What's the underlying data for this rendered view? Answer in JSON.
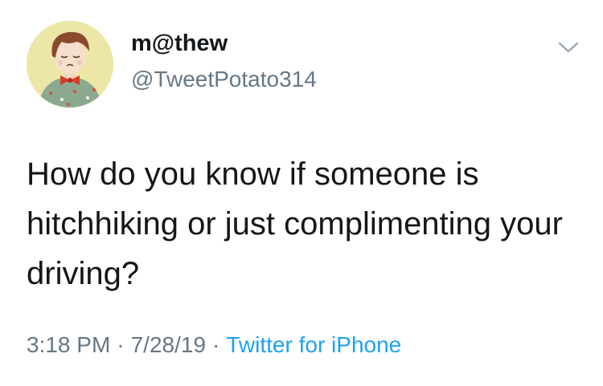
{
  "author": {
    "display_name": "m@thew",
    "handle": "@TweetPotato314",
    "avatar_icon": "cartoon-boy-avatar"
  },
  "tweet": {
    "text": "How do you know if someone is hitchhiking or just complimenting your driving?"
  },
  "meta": {
    "time": "3:18 PM",
    "separator": "·",
    "date": "7/28/19",
    "source": "Twitter for iPhone"
  },
  "menu": {
    "icon": "chevron-down-icon"
  },
  "colors": {
    "text": "#14171a",
    "secondary": "#657786",
    "link": "#1da1f2",
    "avatar_bg": "#ece7a6"
  }
}
